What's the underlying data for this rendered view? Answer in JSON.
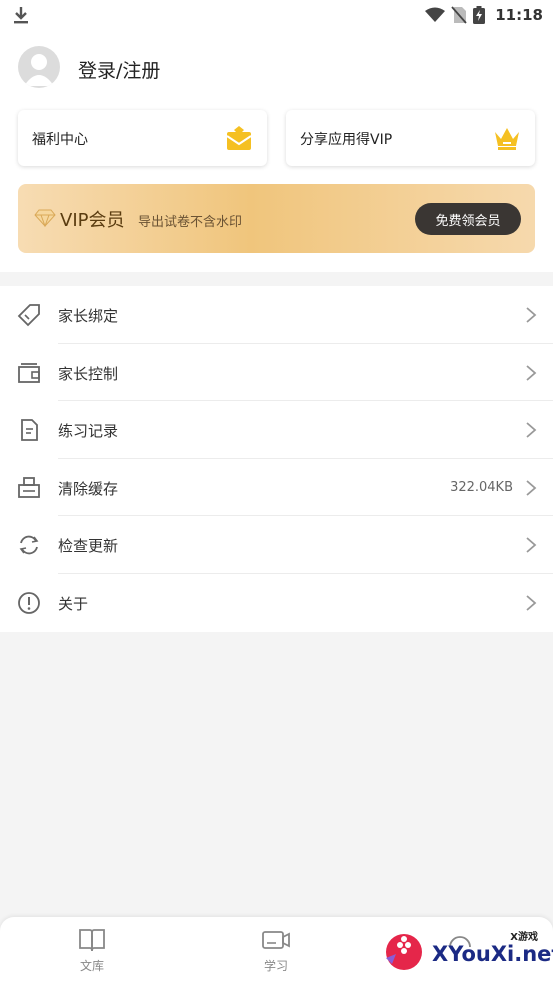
{
  "statusbar": {
    "time": "11:18"
  },
  "profile": {
    "login_label": "登录/注册"
  },
  "cards": {
    "welfare_label": "福利中心",
    "share_label": "分享应用得VIP"
  },
  "vip": {
    "title": "VIP会员",
    "subtitle": "导出试卷不含水印",
    "button_label": "免费领会员"
  },
  "menu": {
    "items": [
      {
        "label": "家长绑定",
        "icon": "tag-icon",
        "value": ""
      },
      {
        "label": "家长控制",
        "icon": "wallet-icon",
        "value": ""
      },
      {
        "label": "练习记录",
        "icon": "document-icon",
        "value": ""
      },
      {
        "label": "清除缓存",
        "icon": "printer-icon",
        "value": "322.04KB"
      },
      {
        "label": "检查更新",
        "icon": "refresh-icon",
        "value": ""
      },
      {
        "label": "关于",
        "icon": "info-icon",
        "value": ""
      }
    ]
  },
  "tabbar": {
    "tabs": [
      {
        "label": "文库",
        "icon": "book-icon"
      },
      {
        "label": "学习",
        "icon": "video-icon"
      }
    ]
  },
  "watermark": {
    "text": "XYouXi.net",
    "small": "X游戏"
  },
  "colors": {
    "accent_gold": "#f0c57c",
    "vip_button": "#3a3633",
    "icon_yellow": "#f5c022"
  }
}
